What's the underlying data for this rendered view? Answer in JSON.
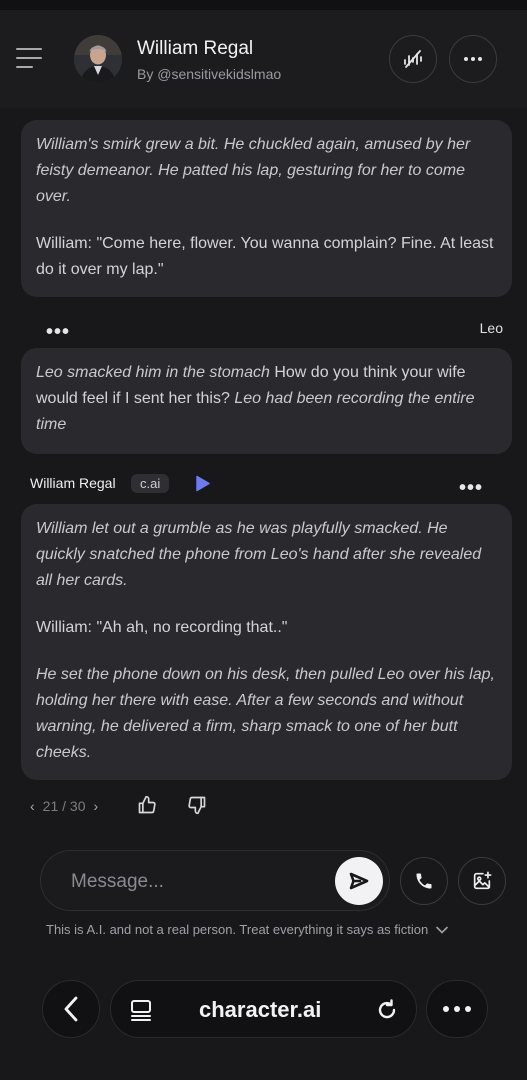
{
  "header": {
    "character_name": "William Regal",
    "author": "By @sensitivekidslmao"
  },
  "messages": [
    {
      "sender": "William Regal",
      "paragraphs": [
        "William's smirk grew a bit. He chuckled again, amused by her feisty demeanor. He patted his lap, gesturing for her to come over.",
        "William: \"Come here, flower. You wanna complain? Fine. At least do it over my lap.\""
      ]
    },
    {
      "sender": "Leo",
      "action_1": "Leo smacked him in the stomach",
      "speech": "How do you think your wife would feel if I sent her this?",
      "action_2": "Leo had been recording the entire time"
    },
    {
      "sender": "William Regal",
      "badge": "c.ai",
      "paragraphs": [
        "William let out a grumble as he was playfully smacked. He quickly snatched the phone from Leo's hand after she revealed all her cards.",
        "William: \"Ah ah, no recording that..\"",
        "He set the phone down on his desk, then pulled Leo over his lap, holding her there with ease. After a few seconds and without warning, he delivered a firm, sharp smack to one of her butt cheeks."
      ],
      "pager": "21 / 30"
    }
  ],
  "composer": {
    "placeholder": "Message..."
  },
  "disclaimer": "This is A.I. and not a real person. Treat everything it says as fiction",
  "browser": {
    "url": "character.ai"
  },
  "icons": [
    "menu-icon",
    "voice-call-off-icon",
    "more-icon",
    "play-icon",
    "chevron-left-icon",
    "chevron-right-icon",
    "thumbs-up-icon",
    "thumbs-down-icon",
    "send-icon",
    "phone-icon",
    "image-add-icon",
    "chevron-down-icon",
    "back-icon",
    "tabs-icon",
    "reload-icon"
  ],
  "colors": {
    "background": "#18181b",
    "bubble": "#2a2a2e",
    "accent_play": "#6d7bf0"
  }
}
